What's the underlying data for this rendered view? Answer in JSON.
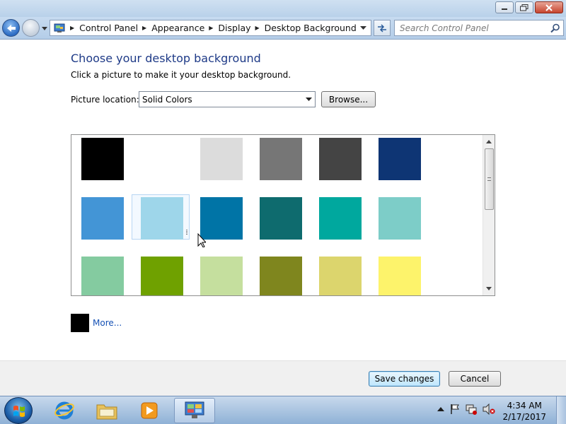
{
  "window": {
    "minimize_label": "Minimize",
    "maximize_label": "Maximize",
    "close_label": "Close"
  },
  "address": {
    "crumbs": [
      "Control Panel",
      "Appearance",
      "Display",
      "Desktop Background"
    ],
    "search_placeholder": "Search Control Panel"
  },
  "page": {
    "title": "Choose your desktop background",
    "subtitle": "Click a picture to make it your desktop background.",
    "location_label": "Picture location:",
    "location_value": "Solid Colors",
    "browse_label": "Browse...",
    "more_label": "More...",
    "current_color": "#000000"
  },
  "swatches": [
    "#000000",
    "#ffffff",
    "#dcdcdc",
    "#767676",
    "#444444",
    "#0e3574",
    "#4395d6",
    "#9ed6ea",
    "#0074a6",
    "#0e6b6e",
    "#00a89e",
    "#7dcdc8",
    "#84cba0",
    "#6fa100",
    "#c5df9e",
    "#7f861e",
    "#dcd56d",
    "#fdf36b"
  ],
  "footer": {
    "save_label": "Save changes",
    "cancel_label": "Cancel"
  },
  "taskbar": {
    "time": "4:34 AM",
    "date": "2/17/2017"
  }
}
